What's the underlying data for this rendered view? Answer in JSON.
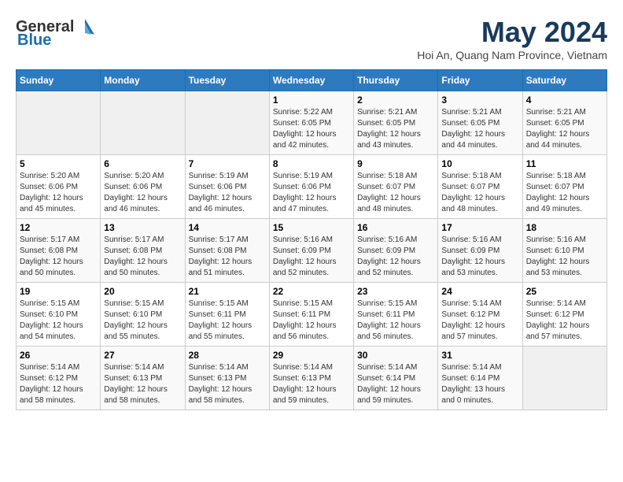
{
  "logo": {
    "general": "General",
    "blue": "Blue"
  },
  "title": "May 2024",
  "subtitle": "Hoi An, Quang Nam Province, Vietnam",
  "days_of_week": [
    "Sunday",
    "Monday",
    "Tuesday",
    "Wednesday",
    "Thursday",
    "Friday",
    "Saturday"
  ],
  "weeks": [
    [
      {
        "day": "",
        "info": ""
      },
      {
        "day": "",
        "info": ""
      },
      {
        "day": "",
        "info": ""
      },
      {
        "day": "1",
        "info": "Sunrise: 5:22 AM\nSunset: 6:05 PM\nDaylight: 12 hours and 42 minutes."
      },
      {
        "day": "2",
        "info": "Sunrise: 5:21 AM\nSunset: 6:05 PM\nDaylight: 12 hours and 43 minutes."
      },
      {
        "day": "3",
        "info": "Sunrise: 5:21 AM\nSunset: 6:05 PM\nDaylight: 12 hours and 44 minutes."
      },
      {
        "day": "4",
        "info": "Sunrise: 5:21 AM\nSunset: 6:05 PM\nDaylight: 12 hours and 44 minutes."
      }
    ],
    [
      {
        "day": "5",
        "info": "Sunrise: 5:20 AM\nSunset: 6:06 PM\nDaylight: 12 hours and 45 minutes."
      },
      {
        "day": "6",
        "info": "Sunrise: 5:20 AM\nSunset: 6:06 PM\nDaylight: 12 hours and 46 minutes."
      },
      {
        "day": "7",
        "info": "Sunrise: 5:19 AM\nSunset: 6:06 PM\nDaylight: 12 hours and 46 minutes."
      },
      {
        "day": "8",
        "info": "Sunrise: 5:19 AM\nSunset: 6:06 PM\nDaylight: 12 hours and 47 minutes."
      },
      {
        "day": "9",
        "info": "Sunrise: 5:18 AM\nSunset: 6:07 PM\nDaylight: 12 hours and 48 minutes."
      },
      {
        "day": "10",
        "info": "Sunrise: 5:18 AM\nSunset: 6:07 PM\nDaylight: 12 hours and 48 minutes."
      },
      {
        "day": "11",
        "info": "Sunrise: 5:18 AM\nSunset: 6:07 PM\nDaylight: 12 hours and 49 minutes."
      }
    ],
    [
      {
        "day": "12",
        "info": "Sunrise: 5:17 AM\nSunset: 6:08 PM\nDaylight: 12 hours and 50 minutes."
      },
      {
        "day": "13",
        "info": "Sunrise: 5:17 AM\nSunset: 6:08 PM\nDaylight: 12 hours and 50 minutes."
      },
      {
        "day": "14",
        "info": "Sunrise: 5:17 AM\nSunset: 6:08 PM\nDaylight: 12 hours and 51 minutes."
      },
      {
        "day": "15",
        "info": "Sunrise: 5:16 AM\nSunset: 6:09 PM\nDaylight: 12 hours and 52 minutes."
      },
      {
        "day": "16",
        "info": "Sunrise: 5:16 AM\nSunset: 6:09 PM\nDaylight: 12 hours and 52 minutes."
      },
      {
        "day": "17",
        "info": "Sunrise: 5:16 AM\nSunset: 6:09 PM\nDaylight: 12 hours and 53 minutes."
      },
      {
        "day": "18",
        "info": "Sunrise: 5:16 AM\nSunset: 6:10 PM\nDaylight: 12 hours and 53 minutes."
      }
    ],
    [
      {
        "day": "19",
        "info": "Sunrise: 5:15 AM\nSunset: 6:10 PM\nDaylight: 12 hours and 54 minutes."
      },
      {
        "day": "20",
        "info": "Sunrise: 5:15 AM\nSunset: 6:10 PM\nDaylight: 12 hours and 55 minutes."
      },
      {
        "day": "21",
        "info": "Sunrise: 5:15 AM\nSunset: 6:11 PM\nDaylight: 12 hours and 55 minutes."
      },
      {
        "day": "22",
        "info": "Sunrise: 5:15 AM\nSunset: 6:11 PM\nDaylight: 12 hours and 56 minutes."
      },
      {
        "day": "23",
        "info": "Sunrise: 5:15 AM\nSunset: 6:11 PM\nDaylight: 12 hours and 56 minutes."
      },
      {
        "day": "24",
        "info": "Sunrise: 5:14 AM\nSunset: 6:12 PM\nDaylight: 12 hours and 57 minutes."
      },
      {
        "day": "25",
        "info": "Sunrise: 5:14 AM\nSunset: 6:12 PM\nDaylight: 12 hours and 57 minutes."
      }
    ],
    [
      {
        "day": "26",
        "info": "Sunrise: 5:14 AM\nSunset: 6:12 PM\nDaylight: 12 hours and 58 minutes."
      },
      {
        "day": "27",
        "info": "Sunrise: 5:14 AM\nSunset: 6:13 PM\nDaylight: 12 hours and 58 minutes."
      },
      {
        "day": "28",
        "info": "Sunrise: 5:14 AM\nSunset: 6:13 PM\nDaylight: 12 hours and 58 minutes."
      },
      {
        "day": "29",
        "info": "Sunrise: 5:14 AM\nSunset: 6:13 PM\nDaylight: 12 hours and 59 minutes."
      },
      {
        "day": "30",
        "info": "Sunrise: 5:14 AM\nSunset: 6:14 PM\nDaylight: 12 hours and 59 minutes."
      },
      {
        "day": "31",
        "info": "Sunrise: 5:14 AM\nSunset: 6:14 PM\nDaylight: 13 hours and 0 minutes."
      },
      {
        "day": "",
        "info": ""
      }
    ]
  ]
}
